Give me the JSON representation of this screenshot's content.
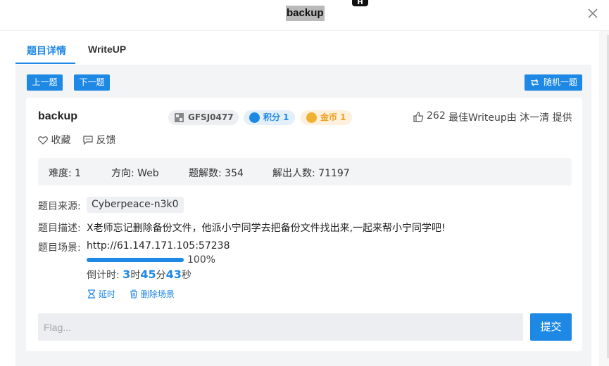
{
  "header": {
    "title": "backup",
    "badge": "H"
  },
  "tabs": [
    {
      "label": "题目详情",
      "active": true
    },
    {
      "label": "WriteUP",
      "active": false
    }
  ],
  "toolbar": {
    "prev_label": "上一题",
    "next_label": "下一题",
    "random_label": "随机一题"
  },
  "challenge": {
    "name": "backup",
    "id_tag": "GFSJ0477",
    "points_tag": "积分 1",
    "coins_tag": "金币 1",
    "likes": "262",
    "writeup_credit": "最佳Writeup由 沐一清 提供",
    "favorite_label": "收藏",
    "feedback_label": "反馈"
  },
  "stats": {
    "difficulty": "难度: 1",
    "direction": "方向: Web",
    "solves": "题解数: 354",
    "solvers": "解出人数: 71197"
  },
  "details": {
    "source_label": "题目来源:",
    "source_value": "Cyberpeace-n3k0",
    "desc_label": "题目描述:",
    "desc_value": "X老师忘记删除备份文件，他派小宁同学去把备份文件找出来,一起来帮小宁同学吧!",
    "scene_label": "题目场景:",
    "scene_url": "http://61.147.171.105:57238",
    "progress": 1.0,
    "progress_text": "100%",
    "timer_prefix": "倒计时: ",
    "timer_h": "3",
    "timer_h_unit": "时",
    "timer_m": "45",
    "timer_m_unit": "分",
    "timer_s": "43",
    "timer_s_unit": "秒",
    "extend_label": "延时",
    "delete_label": "删除场景"
  },
  "flag": {
    "placeholder": "Flag...",
    "submit_label": "提交"
  },
  "colors": {
    "accent": "#1e88e5",
    "points_bg": "#e3f0fb",
    "coins_bg": "#fdf0dc",
    "coins_text": "#f0a020"
  }
}
